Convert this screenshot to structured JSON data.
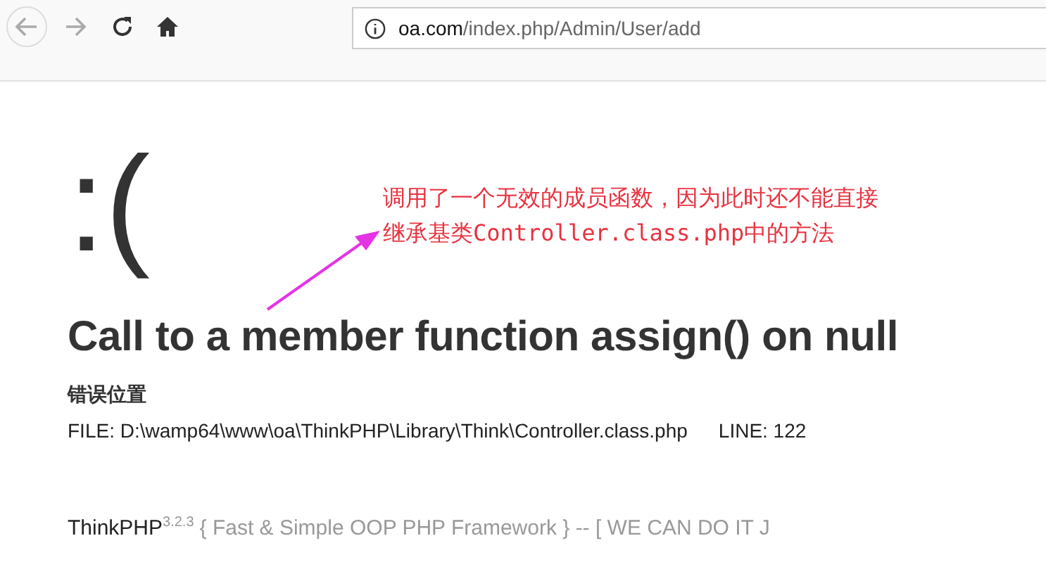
{
  "browser": {
    "url_host": "oa.com",
    "url_path": "/index.php/Admin/User/add"
  },
  "page": {
    "face": ":(",
    "annotation": {
      "lines": [
        "调用了一个无效的成员函数，因为此时还不能直接",
        "继承基类Controller.class.php中的方法"
      ]
    },
    "message": "Call to a member function assign() on null",
    "location_heading": "错误位置",
    "file": "FILE: D:\\wamp64\\www\\oa\\ThinkPHP\\Library\\Think\\Controller.class.php",
    "line": "LINE: 122",
    "footer": {
      "name": "ThinkPHP",
      "version": "3.2.3",
      "tagline": "{ Fast & Simple OOP PHP Framework } -- [ WE CAN DO IT J"
    }
  }
}
